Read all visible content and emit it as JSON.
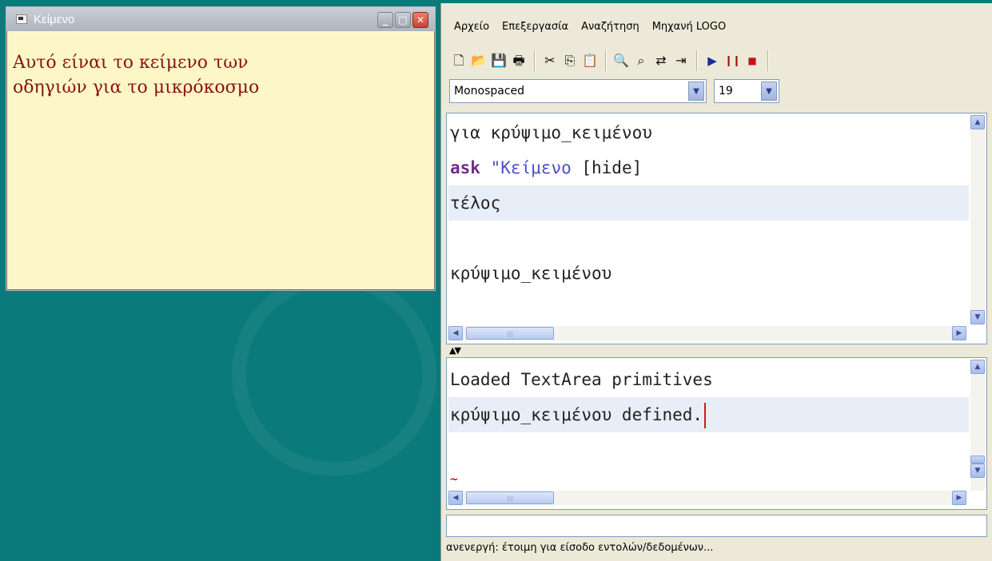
{
  "text_window": {
    "title": "Κείμενο",
    "content": "Αυτό είναι το κείμενο των\nοδηγιών για το μικρόκοσμο",
    "controls": {
      "minimize": "_",
      "maximize": "□",
      "close": "✕"
    }
  },
  "logo_env": {
    "menu": [
      "Αρχείο",
      "Επεξεργασία",
      "Αναζήτηση",
      "Μηχανή LOGO"
    ],
    "toolbar_icons": [
      "new-document",
      "open-folder",
      "save-disk",
      "print",
      "cut-scissors",
      "copy",
      "paste",
      "find-binoculars",
      "find-next",
      "replace",
      "insert",
      "run-play",
      "pause",
      "stop"
    ],
    "font_combo": "Monospaced",
    "size_combo": "19",
    "editor_lines": [
      {
        "parts": [
          {
            "t": "για κρύψιμο_κειμένου",
            "c": ""
          }
        ]
      },
      {
        "parts": [
          {
            "t": "ask",
            "c": "kw"
          },
          {
            "t": " \"Κείμενο",
            "c": "str"
          },
          {
            "t": " [hide]",
            "c": ""
          }
        ]
      },
      {
        "parts": [
          {
            "t": "τέλος",
            "c": ""
          }
        ],
        "highlight": true
      },
      {
        "parts": [
          {
            "t": "",
            "c": ""
          }
        ]
      },
      {
        "parts": [
          {
            "t": "κρύψιμο_κειμένου",
            "c": ""
          }
        ]
      }
    ],
    "console_lines": [
      {
        "text": "Loaded TextArea primitives"
      },
      {
        "text": "κρύψιμο_κειμένου defined.",
        "highlight": true,
        "caret": true
      }
    ],
    "console_marker": "~",
    "status": "ανενεργή: έτοιμη για είσοδο εντολών/δεδομένων..."
  },
  "colors": {
    "desktop": "#0b7a7a",
    "text_window_bg": "#fdf7c8",
    "text_window_fg": "#8b1212",
    "keyword": "#6d2e8b",
    "string": "#4b50c8",
    "line_highlight": "#e8eef7",
    "caret": "#d21a1a"
  }
}
